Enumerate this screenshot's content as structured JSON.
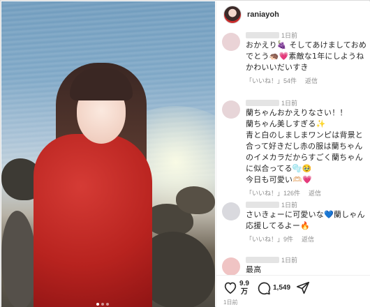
{
  "post": {
    "username": "raniayoh",
    "photo_alt": ""
  },
  "comments": [
    {
      "time": "1日前",
      "text": "おかえり🍇 そしてあけましておめでとう🦔💗素敵な1年にしようねかわいいだいすき",
      "like_label": "「いいね！」54件",
      "reply_label": "返信"
    },
    {
      "time": "1日前",
      "text": "蘭ちゃんおかえりなさい！！\n蘭ちゃん美しすぎる✨\n青と白のしましまワンピは背景と合って好きだし赤の服は蘭ちゃんのイメカラだからすごく蘭ちゃんに似合ってる🫧🥹\n今日も可愛い🫶🏻💗",
      "like_label": "「いいね！」126件",
      "reply_label": "返信"
    },
    {
      "time": "1日前",
      "text": "さいきょーに可愛いな💙蘭しゃん応援してるよー🔥",
      "like_label": "「いいね！」9件",
      "reply_label": "返信"
    },
    {
      "time": "1日前",
      "text": "最高",
      "like_label": "",
      "reply_label": ""
    }
  ],
  "footer": {
    "like_count_top": "9.9",
    "like_count_bottom": "万",
    "comment_count": "1,549",
    "time": "1日前",
    "icons": [
      "heart-icon",
      "comment-icon",
      "share-icon"
    ]
  }
}
